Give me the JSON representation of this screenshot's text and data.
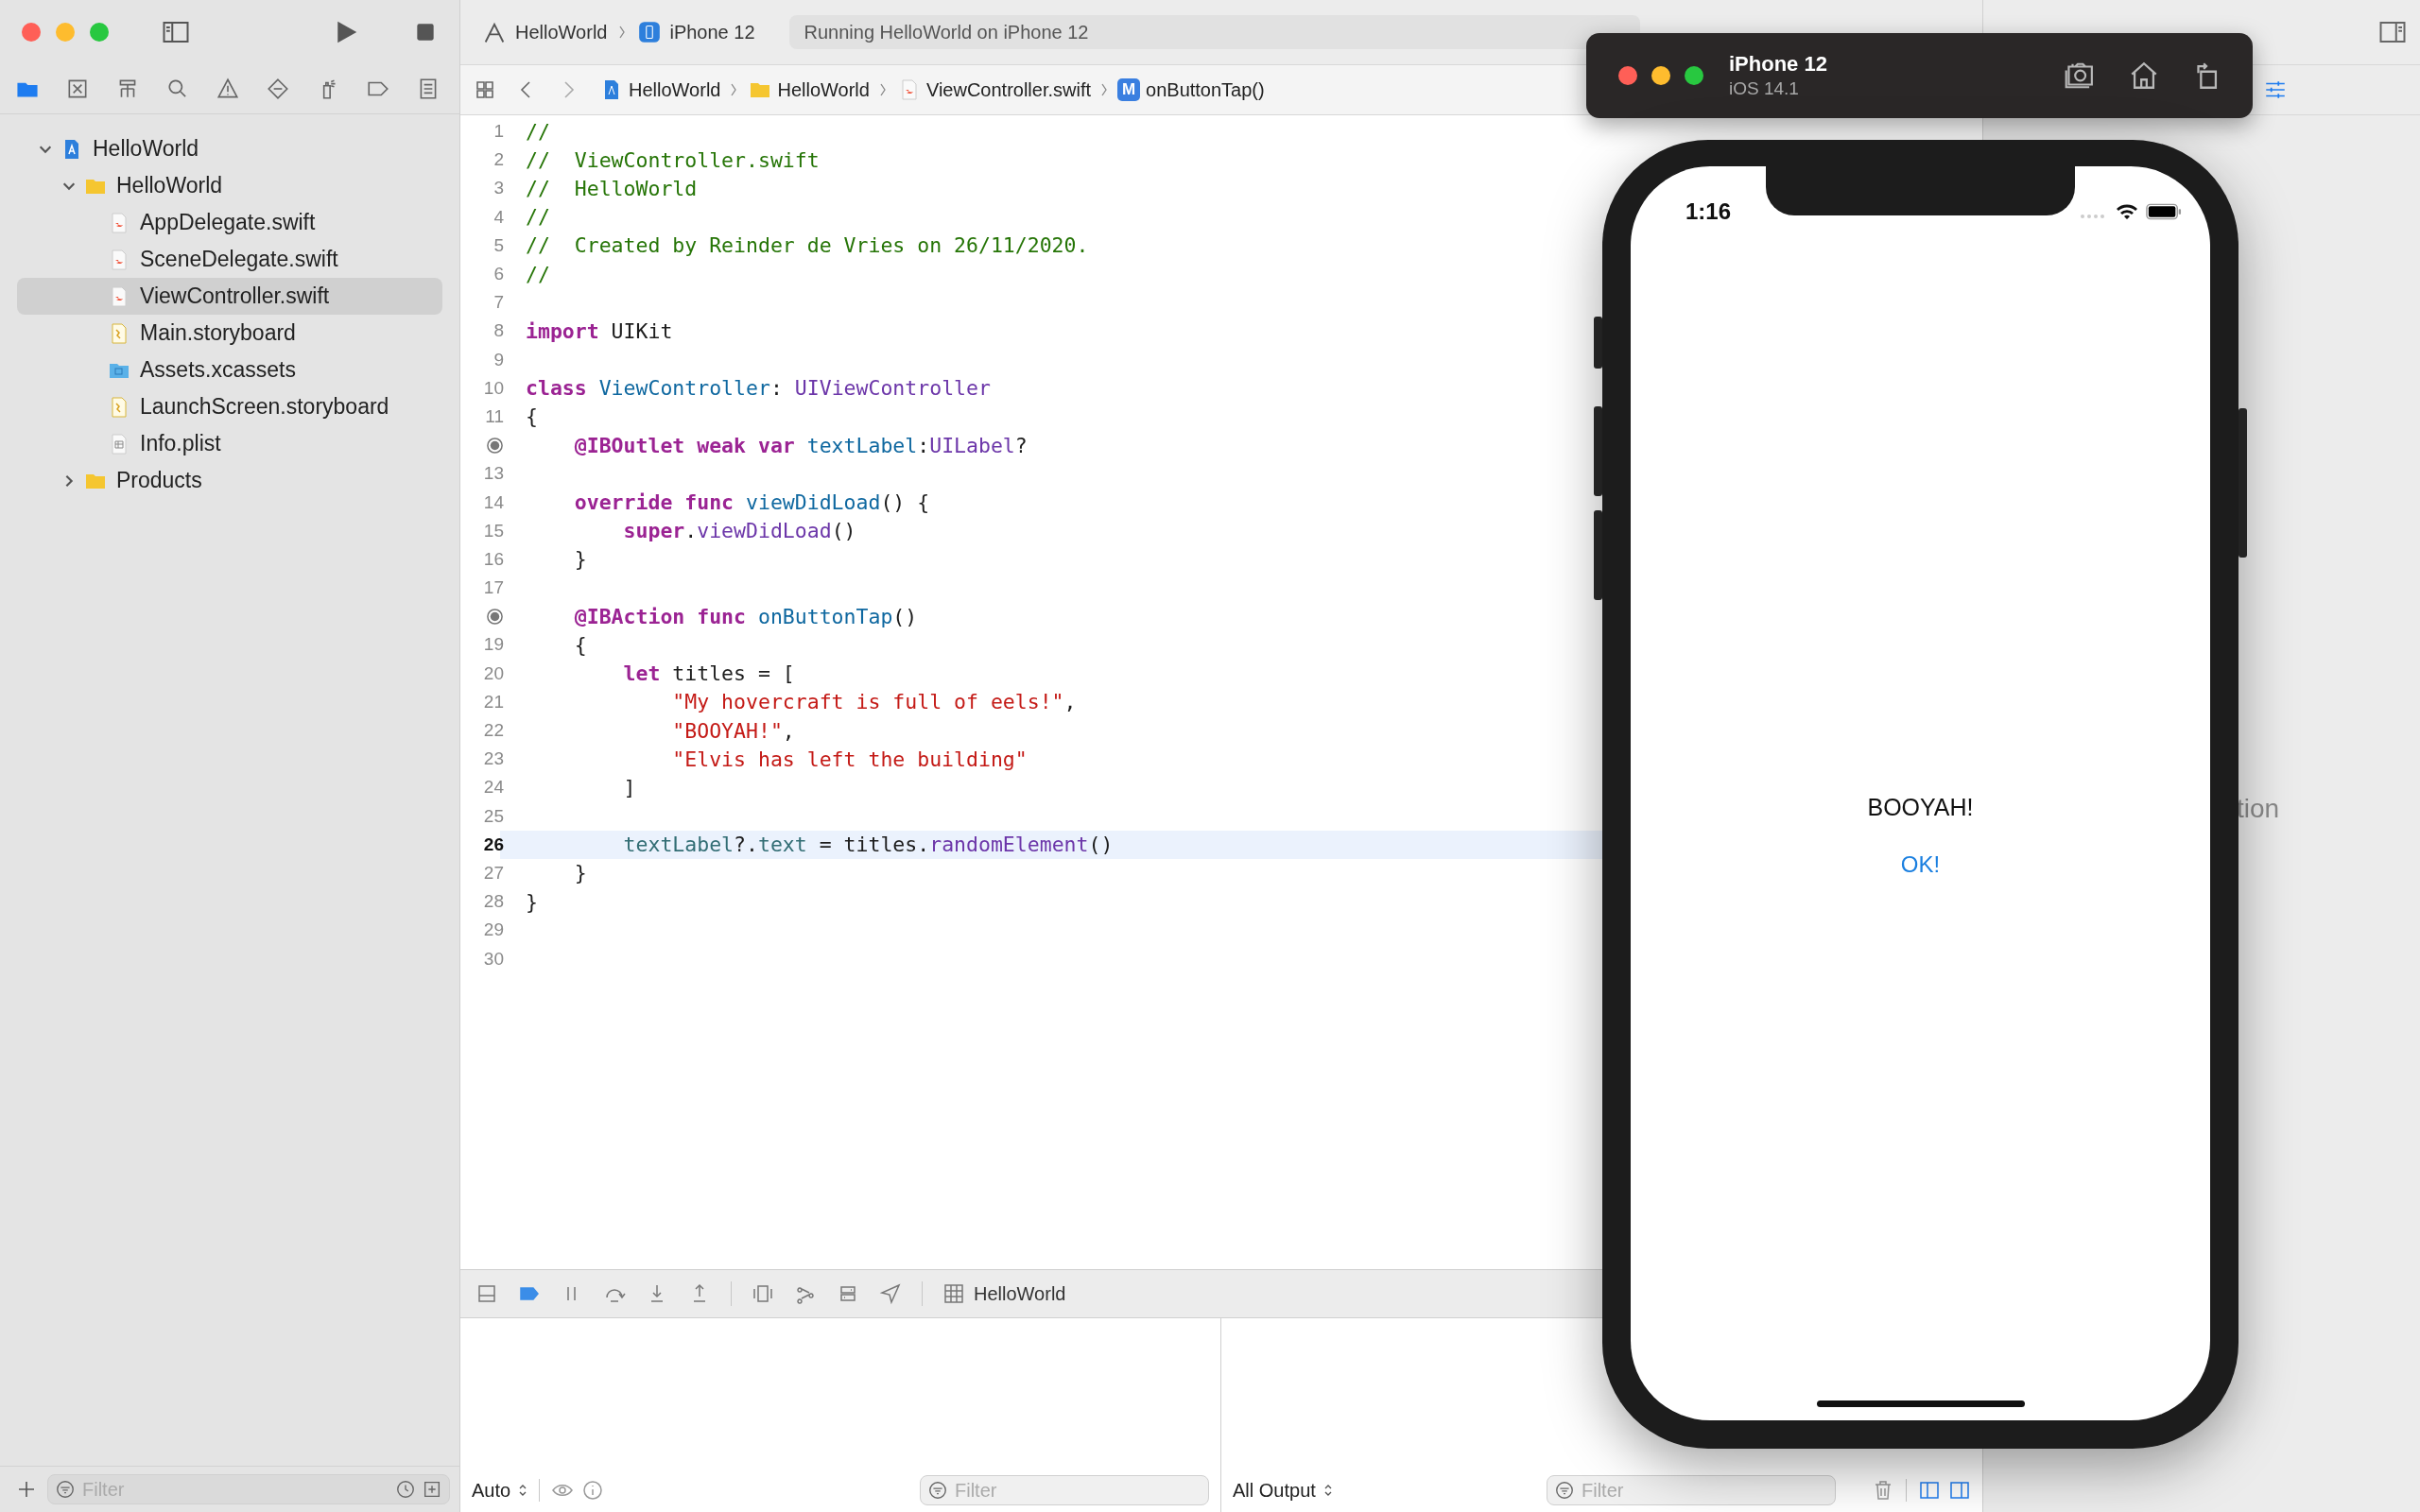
{
  "toolbar": {
    "scheme": "HelloWorld",
    "destination": "iPhone 12",
    "activity": "Running HelloWorld on iPhone 12"
  },
  "navigator_tabs": [
    {
      "selected": true
    },
    {
      "selected": false
    },
    {
      "selected": false
    },
    {
      "selected": false
    },
    {
      "selected": false
    },
    {
      "selected": false
    },
    {
      "selected": false
    },
    {
      "selected": false
    },
    {
      "selected": false
    }
  ],
  "tree": [
    {
      "label": "HelloWorld",
      "kind": "project",
      "expanded": true,
      "selected": false,
      "children": [
        {
          "label": "HelloWorld",
          "kind": "folder",
          "expanded": true,
          "selected": false,
          "children": [
            {
              "label": "AppDelegate.swift",
              "kind": "swift",
              "selected": false
            },
            {
              "label": "SceneDelegate.swift",
              "kind": "swift",
              "selected": false
            },
            {
              "label": "ViewController.swift",
              "kind": "swift",
              "selected": true
            },
            {
              "label": "Main.storyboard",
              "kind": "storyboard",
              "selected": false
            },
            {
              "label": "Assets.xcassets",
              "kind": "assets",
              "selected": false
            },
            {
              "label": "LaunchScreen.storyboard",
              "kind": "storyboard",
              "selected": false
            },
            {
              "label": "Info.plist",
              "kind": "plist",
              "selected": false
            }
          ]
        },
        {
          "label": "Products",
          "kind": "folder",
          "expanded": false,
          "selected": false
        }
      ]
    }
  ],
  "sidebar_filter": {
    "placeholder": "Filter"
  },
  "breadcrumbs": [
    {
      "label": "HelloWorld",
      "kind": "project"
    },
    {
      "label": "HelloWorld",
      "kind": "folder"
    },
    {
      "label": "ViewController.swift",
      "kind": "swift"
    },
    {
      "label": "onButtonTap()",
      "kind": "method",
      "badge": "M"
    }
  ],
  "code": {
    "lines": [
      {
        "number": "1",
        "connected": false,
        "current": false,
        "tokens": [
          {
            "text": "//",
            "kind": "comment"
          }
        ]
      },
      {
        "number": "2",
        "connected": false,
        "current": false,
        "tokens": [
          {
            "text": "//  ViewController.swift",
            "kind": "comment"
          }
        ]
      },
      {
        "number": "3",
        "connected": false,
        "current": false,
        "tokens": [
          {
            "text": "//  HelloWorld",
            "kind": "comment"
          }
        ]
      },
      {
        "number": "4",
        "connected": false,
        "current": false,
        "tokens": [
          {
            "text": "//",
            "kind": "comment"
          }
        ]
      },
      {
        "number": "5",
        "connected": false,
        "current": false,
        "tokens": [
          {
            "text": "//  Created by Reinder de Vries on 26/11/2020.",
            "kind": "comment"
          }
        ]
      },
      {
        "number": "6",
        "connected": false,
        "current": false,
        "tokens": [
          {
            "text": "//",
            "kind": "comment"
          }
        ]
      },
      {
        "number": "7",
        "connected": false,
        "current": false
      },
      {
        "number": "8",
        "connected": false,
        "current": false,
        "tokens": [
          {
            "text": "import",
            "kind": "keyword"
          },
          {
            "text": " UIKit",
            "kind": "plain"
          }
        ]
      },
      {
        "number": "9",
        "connected": false,
        "current": false
      },
      {
        "number": "10",
        "connected": false,
        "current": false,
        "tokens": [
          {
            "text": "class",
            "kind": "keyword"
          },
          {
            "text": " ViewController",
            "kind": "declaration"
          },
          {
            "text": ": ",
            "kind": "plain"
          },
          {
            "text": "UIViewController",
            "kind": "type"
          }
        ]
      },
      {
        "number": "11",
        "connected": false,
        "current": false,
        "tokens": [
          {
            "text": "{",
            "kind": "plain"
          }
        ]
      },
      {
        "connected": true,
        "current": false,
        "tokens": [
          {
            "text": "    @IBOutlet weak var",
            "kind": "keyword"
          },
          {
            "text": " textLabel",
            "kind": "declaration"
          },
          {
            "text": ":",
            "kind": "plain"
          },
          {
            "text": "UILabel",
            "kind": "type"
          },
          {
            "text": "?",
            "kind": "plain"
          }
        ]
      },
      {
        "number": "13",
        "connected": false,
        "current": false
      },
      {
        "number": "14",
        "connected": false,
        "current": false,
        "tokens": [
          {
            "text": "    override func",
            "kind": "keyword"
          },
          {
            "text": " viewDidLoad",
            "kind": "declaration"
          },
          {
            "text": "() {",
            "kind": "plain"
          }
        ]
      },
      {
        "number": "15",
        "connected": false,
        "current": false,
        "tokens": [
          {
            "text": "        super",
            "kind": "keyword"
          },
          {
            "text": ".",
            "kind": "plain"
          },
          {
            "text": "viewDidLoad",
            "kind": "type"
          },
          {
            "text": "()",
            "kind": "plain"
          }
        ]
      },
      {
        "number": "16",
        "connected": false,
        "current": false,
        "tokens": [
          {
            "text": "    }",
            "kind": "plain"
          }
        ]
      },
      {
        "number": "17",
        "connected": false,
        "current": false
      },
      {
        "connected": true,
        "current": false,
        "tokens": [
          {
            "text": "    @IBAction func",
            "kind": "keyword"
          },
          {
            "text": " onButtonTap",
            "kind": "declaration"
          },
          {
            "text": "()",
            "kind": "plain"
          }
        ]
      },
      {
        "number": "19",
        "connected": false,
        "current": false,
        "tokens": [
          {
            "text": "    {",
            "kind": "plain"
          }
        ]
      },
      {
        "number": "20",
        "connected": false,
        "current": false,
        "tokens": [
          {
            "text": "        let",
            "kind": "keyword"
          },
          {
            "text": " titles = [",
            "kind": "plain"
          }
        ]
      },
      {
        "number": "21",
        "connected": false,
        "current": false,
        "tokens": [
          {
            "text": "            \"My hovercraft is full of eels!\"",
            "kind": "string"
          },
          {
            "text": ",",
            "kind": "plain"
          }
        ]
      },
      {
        "number": "22",
        "connected": false,
        "current": false,
        "tokens": [
          {
            "text": "            \"BOOYAH!\"",
            "kind": "string"
          },
          {
            "text": ",",
            "kind": "plain"
          }
        ]
      },
      {
        "number": "23",
        "connected": false,
        "current": false,
        "tokens": [
          {
            "text": "            \"Elvis has left the building\"",
            "kind": "string"
          }
        ]
      },
      {
        "number": "24",
        "connected": false,
        "current": false,
        "tokens": [
          {
            "text": "        ]",
            "kind": "plain"
          }
        ]
      },
      {
        "number": "25",
        "connected": false,
        "current": false
      },
      {
        "number": "26",
        "connected": false,
        "current": true,
        "tokens": [
          {
            "text": "        textLabel",
            "kind": "member"
          },
          {
            "text": "?.",
            "kind": "plain"
          },
          {
            "text": "text",
            "kind": "member"
          },
          {
            "text": " = titles.",
            "kind": "plain"
          },
          {
            "text": "randomElement",
            "kind": "type"
          },
          {
            "text": "()",
            "kind": "plain"
          }
        ]
      },
      {
        "number": "27",
        "connected": false,
        "current": false,
        "tokens": [
          {
            "text": "    }",
            "kind": "plain"
          }
        ]
      },
      {
        "number": "28",
        "connected": false,
        "current": false,
        "tokens": [
          {
            "text": "}",
            "kind": "plain"
          }
        ]
      },
      {
        "number": "29",
        "connected": false,
        "current": false
      },
      {
        "number": "30",
        "connected": false,
        "current": false
      }
    ]
  },
  "debug_bar": {
    "target": "HelloWorld"
  },
  "variables_pane": {
    "scope": "Auto",
    "filter_placeholder": "Filter"
  },
  "console_pane": {
    "output": "All Output",
    "filter_placeholder": "Filter"
  },
  "inspector": {
    "partial_text": "tion"
  },
  "simulator": {
    "device": "iPhone 12",
    "os": "iOS 14.1",
    "time": "1:16",
    "label": "BOOYAH!",
    "button": "OK!"
  }
}
